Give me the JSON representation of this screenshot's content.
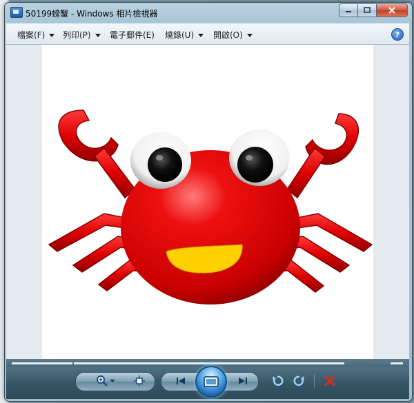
{
  "window": {
    "title": "50199螃蟹 - Windows 相片檢視器"
  },
  "menu": [
    {
      "label": "檔案(F)",
      "has_caret": true
    },
    {
      "label": "列印(P)",
      "has_caret": true
    },
    {
      "label": "電子郵件(E)",
      "has_caret": false
    },
    {
      "label": "燒錄(U)",
      "has_caret": true
    },
    {
      "label": "開啟(O)",
      "has_caret": true
    }
  ],
  "help_label": "?",
  "colors": {
    "crab_body": "#e00000",
    "crab_shadow": "#8a0000",
    "mouth": "#ffd000",
    "eye_white": "#ffffff",
    "pupil": "#000000"
  },
  "toolbar_icons": [
    "zoom-icon",
    "fit-window-icon",
    "previous-icon",
    "slideshow-icon",
    "next-icon",
    "rotate-left-icon",
    "rotate-right-icon",
    "delete-icon"
  ]
}
